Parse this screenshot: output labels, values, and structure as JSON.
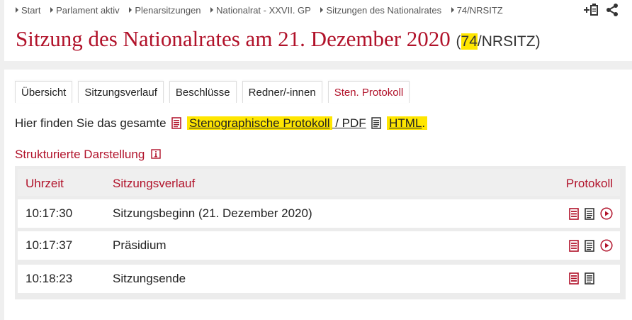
{
  "breadcrumb": [
    "Start",
    "Parlament aktiv",
    "Plenarsitzungen",
    "Nationalrat - XXVII. GP",
    "Sitzungen des Nationalrates",
    "74/NRSITZ"
  ],
  "title": {
    "main": "Sitzung des Nationalrates am 21. Dezember 2020",
    "open": "(",
    "num": "74",
    "rest": "/NRSITZ)"
  },
  "tabs": [
    "Übersicht",
    "Sitzungsverlauf",
    "Beschlüsse",
    "Redner/-innen",
    "Sten. Protokoll"
  ],
  "intro": {
    "text": "Hier finden Sie das gesamte",
    "pdf_link": "Stenographische Protokoll",
    "pdf_suffix": " / PDF",
    "html_link": "HTML",
    "end": "."
  },
  "section_title": "Strukturierte Darstellung",
  "table": {
    "headers": {
      "time": "Uhrzeit",
      "desc": "Sitzungsverlauf",
      "prot": "Protokoll"
    },
    "rows": [
      {
        "time": "10:17:30",
        "desc": "Sitzungsbeginn (21. Dezember 2020)",
        "video": true
      },
      {
        "time": "10:17:37",
        "desc": "Präsidium",
        "video": true
      },
      {
        "time": "10:18:23",
        "desc": "Sitzungsende",
        "video": false
      }
    ]
  },
  "colors": {
    "accent": "#b1122a",
    "highlight": "#ffe600"
  },
  "icons": [
    "add-bookmark-icon",
    "share-icon",
    "pdf-doc-icon",
    "html-doc-icon",
    "info-icon",
    "play-icon"
  ]
}
